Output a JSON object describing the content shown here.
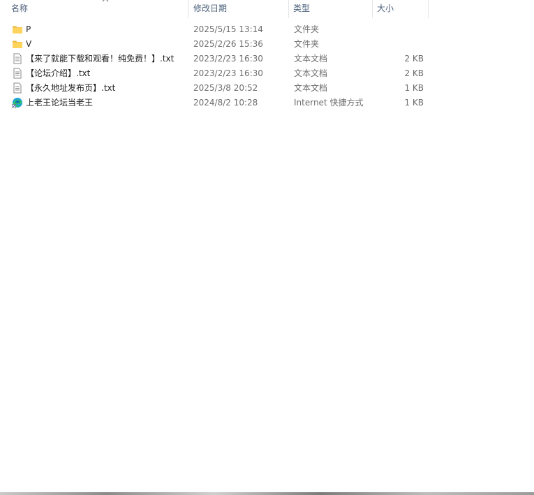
{
  "columns": {
    "name": "名称",
    "date": "修改日期",
    "type": "类型",
    "size": "大小"
  },
  "files": [
    {
      "icon": "folder-icon",
      "name": "P",
      "date": "2025/5/15 13:14",
      "type": "文件夹",
      "size": ""
    },
    {
      "icon": "folder-icon",
      "name": "V",
      "date": "2025/2/26 15:36",
      "type": "文件夹",
      "size": ""
    },
    {
      "icon": "text-file-icon",
      "name": "【来了就能下载和观看！纯免费！】.txt",
      "date": "2023/2/23 16:30",
      "type": "文本文档",
      "size": "2 KB"
    },
    {
      "icon": "text-file-icon",
      "name": "【论坛介绍】.txt",
      "date": "2023/2/23 16:30",
      "type": "文本文档",
      "size": "2 KB"
    },
    {
      "icon": "text-file-icon",
      "name": "【永久地址发布页】.txt",
      "date": "2025/3/8 20:52",
      "type": "文本文档",
      "size": "1 KB"
    },
    {
      "icon": "edge-shortcut-icon",
      "name": "上老王论坛当老王",
      "date": "2024/8/2 10:28",
      "type": "Internet 快捷方式",
      "size": "1 KB"
    }
  ]
}
